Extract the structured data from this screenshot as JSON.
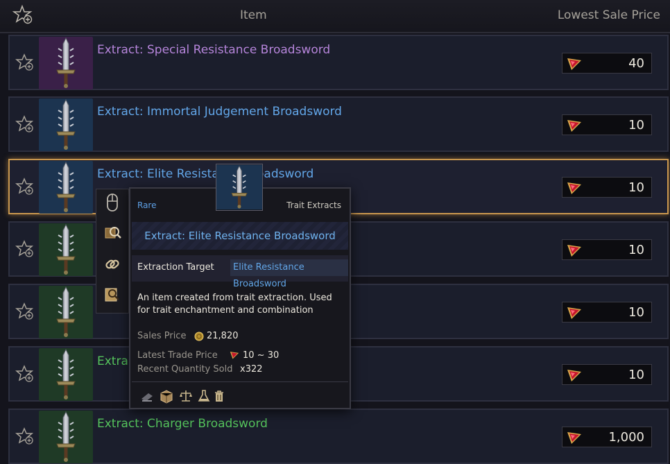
{
  "header": {
    "item_label": "Item",
    "price_label": "Lowest Sale Price",
    "star_icon": "favorite-add-icon"
  },
  "currency_icon": "red-gem-icon",
  "rows": [
    {
      "name": "Extract: Special Resistance Broadsword",
      "price": "40",
      "rarity": "epic",
      "color": "#b685db"
    },
    {
      "name": "Extract: Immortal Judgement Broadsword",
      "price": "10",
      "rarity": "rare",
      "color": "#62a6e8"
    },
    {
      "name": "Extract: Elite Resistance Broadsword",
      "price": "10",
      "rarity": "rare",
      "color": "#62a6e8",
      "selected": true
    },
    {
      "name": "",
      "price": "10",
      "rarity": "uncommon"
    },
    {
      "name": "",
      "price": "10",
      "rarity": "uncommon"
    },
    {
      "name": "Extra",
      "price": "10",
      "rarity": "uncommon",
      "color": "#55c35c"
    },
    {
      "name": "Extract: Charger Broadsword",
      "price": "1,000",
      "rarity": "uncommon",
      "color": "#55c35c"
    }
  ],
  "context_menu": [
    "mouse-icon",
    "search-items-icon",
    "link-icon",
    "inspect-icon"
  ],
  "tooltip": {
    "rarity": "Rare",
    "category": "Trait Extracts",
    "title": "Extract: Elite Resistance Broadsword",
    "target_label": "Extraction Target",
    "target_value": "Elite Resistance Broadsword",
    "description": "An item created from trait extraction. Used for trait enchantment and combination",
    "sales_price_label": "Sales Price",
    "sales_price_value": "21,820",
    "latest_trade_label": "Latest Trade Price",
    "latest_trade_value": "10 ~ 30",
    "recent_qty_label": "Recent Quantity Sold",
    "recent_qty_value": "x322",
    "footer_icons": [
      "trade-icon",
      "storage-box-icon",
      "scales-icon",
      "flask-icon",
      "trash-icon"
    ]
  }
}
